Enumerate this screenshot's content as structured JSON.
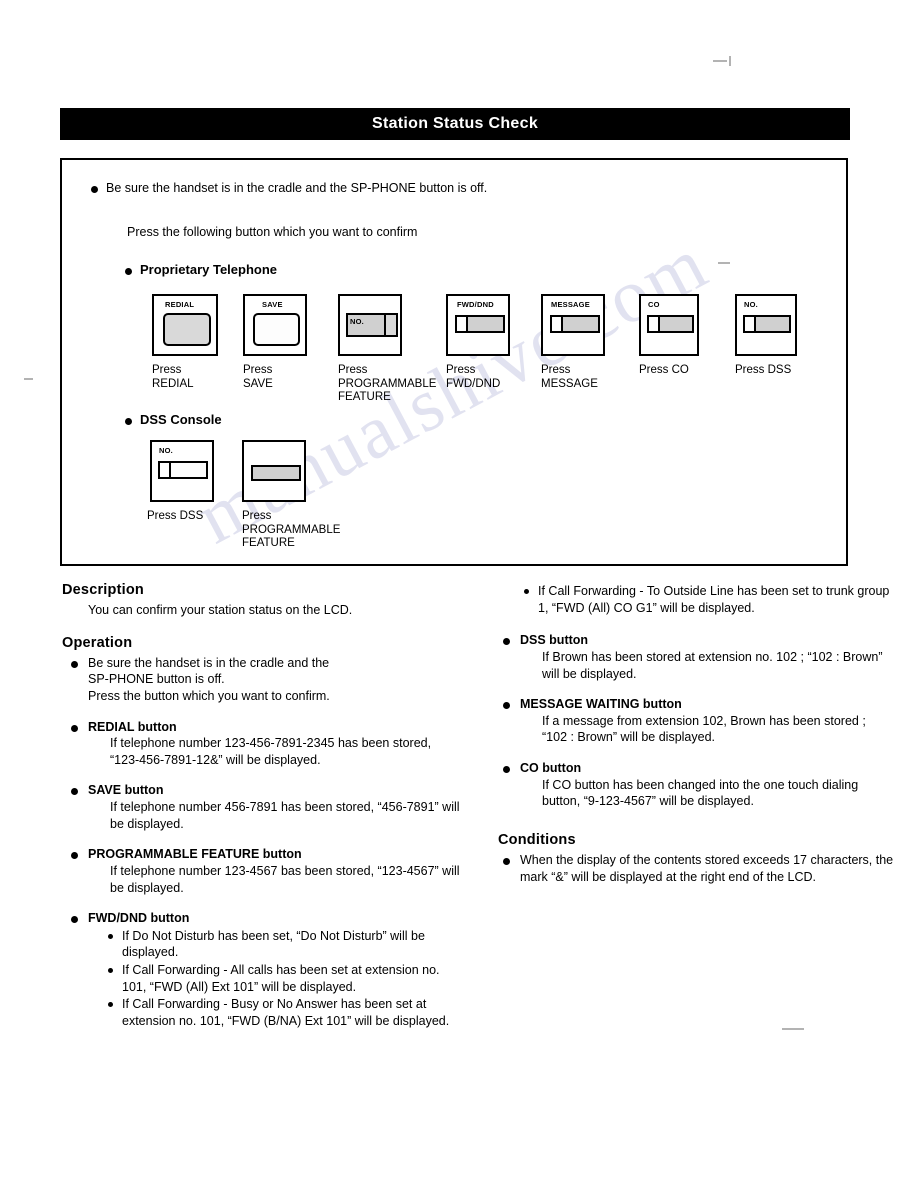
{
  "page": {
    "banner_title": "Station Status Check"
  },
  "frame": {
    "intro_bullet": "Be sure the handset is in the cradle and the SP-PHONE button is off.",
    "intro_instruction": "Press the following button which you want to confirm",
    "section_proprietary": "Proprietary Telephone",
    "section_dss": "DSS Console",
    "proprietary_buttons": [
      {
        "key_label": "REDIAL",
        "caption": "Press\nREDIAL",
        "style": "square-grey"
      },
      {
        "key_label": "SAVE",
        "caption": "Press\nSAVE",
        "style": "square-white"
      },
      {
        "key_label": "NO.",
        "caption": "Press\nPROGRAMMABLE\nFEATURE",
        "style": "bar-no-right"
      },
      {
        "key_label": "FWD/DND",
        "caption": "Press\nFWD/DND",
        "style": "bar-split-left"
      },
      {
        "key_label": "MESSAGE",
        "caption": "Press\nMESSAGE",
        "style": "bar-split-left"
      },
      {
        "key_label": "CO",
        "caption": "Press CO",
        "style": "bar-split-left"
      },
      {
        "key_label": "NO.",
        "caption": "Press DSS",
        "style": "bar-split-left"
      }
    ],
    "dss_buttons": [
      {
        "key_label": "NO.",
        "caption": "Press DSS",
        "style": "bar-split-left"
      },
      {
        "key_label": "",
        "caption": "Press\nPROGRAMMABLE\nFEATURE",
        "style": "bar-plain"
      }
    ]
  },
  "description": {
    "heading": "Description",
    "text": "You can confirm your station status on the LCD."
  },
  "operation": {
    "heading": "Operation",
    "intro_lines": [
      "Be sure the handset is in the cradle and the",
      "SP-PHONE button is off.",
      "Press the button which you want to confirm."
    ],
    "items": [
      {
        "title": "REDIAL button",
        "body": "If telephone number 123-456-7891-2345 has been stored, “123-456-7891-12&” will be displayed."
      },
      {
        "title": "SAVE button",
        "body": "If telephone number 456-7891 has been stored, “456-7891” will be displayed."
      },
      {
        "title": "PROGRAMMABLE FEATURE button",
        "body": "If telephone number 123-4567 bas been stored, “123-4567” will be displayed."
      },
      {
        "title": "FWD/DND button",
        "subitems": [
          "If Do Not Disturb has been set, “Do Not Disturb” will be displayed.",
          "If Call Forwarding - All calls has been set at extension no. 101, “FWD (All) Ext 101” will be displayed.",
          "If Call Forwarding - Busy or No Answer has been set at extension no. 101, “FWD (B/NA) Ext 101” will be displayed."
        ]
      }
    ],
    "right_subitems": [
      "If Call Forwarding - To Outside Line has been set to trunk group 1, “FWD (All) CO G1” will be displayed."
    ],
    "right_items": [
      {
        "title": "DSS button",
        "body": "If Brown has been stored at extension no. 102 ; “102 : Brown” will be displayed."
      },
      {
        "title": "MESSAGE WAITING button",
        "body": "If a message from extension 102, Brown has been stored ; “102 : Brown” will be displayed."
      },
      {
        "title": "CO button",
        "body": "If CO button has been changed into the one touch dialing button, “9-123-4567” will be displayed."
      }
    ]
  },
  "conditions": {
    "heading": "Conditions",
    "items": [
      "When the display of the contents stored exceeds 17 characters, the mark “&” will be displayed at the right end of the LCD."
    ]
  },
  "watermark": {
    "text": "manualshive.com"
  }
}
